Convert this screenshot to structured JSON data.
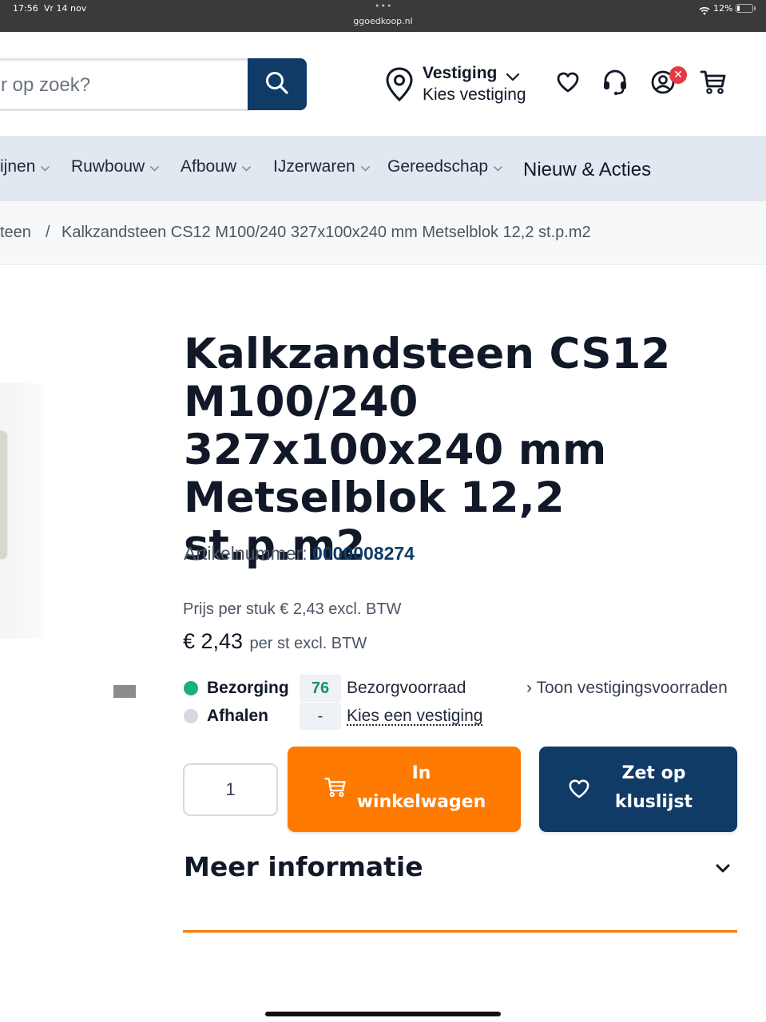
{
  "status_bar": {
    "time": "17:56",
    "date": "Vr 14 nov",
    "dots": "•••",
    "url": "ggoedkoop.nl",
    "battery": "12%"
  },
  "header": {
    "search_placeholder": "r op zoek?",
    "store_title": "Vestiging",
    "store_subtitle": "Kies vestiging",
    "account_badge": "✕"
  },
  "nav": {
    "items": [
      {
        "label": "ijnen"
      },
      {
        "label": "Ruwbouw"
      },
      {
        "label": "Afbouw"
      },
      {
        "label": "IJzerwaren"
      },
      {
        "label": "Gereedschap"
      },
      {
        "label": "Nieuw & Acties"
      }
    ]
  },
  "breadcrumb": {
    "parent": "teen",
    "separator": "/",
    "current": "Kalkzandsteen CS12 M100/240 327x100x240 mm Metselblok 12,2 st.p.m2"
  },
  "product": {
    "title": "Kalkzandsteen CS12 M100/240 327x100x240 mm Metselblok 12,2 st.p.m2",
    "article_label": "Artikelnummer:",
    "article_number": "0000008274",
    "price_per_piece": "Prijs per stuk € 2,43  excl. BTW",
    "price": "€ 2,43",
    "price_unit": "per st excl. BTW"
  },
  "stock": {
    "delivery": {
      "label": "Bezorging",
      "qty": "76",
      "desc": "Bezorgvoorraad",
      "status_color": "#1bb07a"
    },
    "pickup": {
      "label": "Afhalen",
      "qty": "-",
      "desc": "Kies een vestiging",
      "status_color": "#d5d8e0"
    },
    "show_stores": "Toon vestigingsvoorraden"
  },
  "actions": {
    "quantity": "1",
    "add_to_cart_line1": "In",
    "add_to_cart_line2": "winkelwagen",
    "list_line1": "Zet op",
    "list_line2": "kluslijst"
  },
  "more_info": {
    "label": "Meer informatie"
  },
  "colors": {
    "brand_navy": "#0f3b66",
    "accent_orange": "#ff7a00",
    "nav_bg": "#e1e8f0"
  }
}
